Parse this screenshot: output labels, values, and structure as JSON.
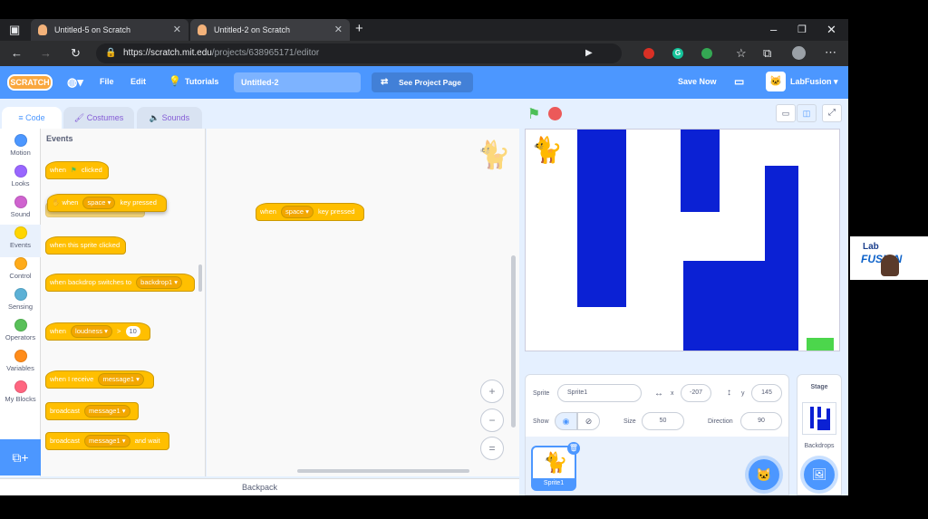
{
  "browser": {
    "tabs": [
      {
        "label": "Untitled-5 on Scratch",
        "active": false
      },
      {
        "label": "Untitled-2 on Scratch",
        "active": true
      }
    ],
    "url_host": "https://scratch.mit.edu",
    "url_path": "/projects/638965171/editor",
    "new_tab": "+",
    "back_icon": "arrow-left-icon",
    "window_icons": [
      "minimize-icon",
      "restore-icon",
      "close-icon"
    ]
  },
  "menu": {
    "logo": "SCRATCH",
    "file": "File",
    "edit": "Edit",
    "tutorials": "Tutorials",
    "project_title": "Untitled-2",
    "see_project": "See Project Page",
    "save_now": "Save Now",
    "username": "LabFusion"
  },
  "editor_tabs": {
    "code": "Code",
    "costumes": "Costumes",
    "sounds": "Sounds"
  },
  "categories": [
    {
      "label": "Motion",
      "color": "#4c97ff"
    },
    {
      "label": "Looks",
      "color": "#9966ff"
    },
    {
      "label": "Sound",
      "color": "#cf63cf"
    },
    {
      "label": "Events",
      "color": "#ffd500"
    },
    {
      "label": "Control",
      "color": "#ffab19"
    },
    {
      "label": "Sensing",
      "color": "#5cb1d6"
    },
    {
      "label": "Operators",
      "color": "#59c059"
    },
    {
      "label": "Variables",
      "color": "#ff8c1a"
    },
    {
      "label": "My Blocks",
      "color": "#ff6680"
    }
  ],
  "palette": {
    "heading": "Events",
    "blocks": {
      "flag_when": "when",
      "flag_clicked": "clicked",
      "key_when": "when",
      "key_value": "space",
      "key_pressed": "key pressed",
      "sprite_clicked": "when this sprite clicked",
      "backdrop_text": "when backdrop switches to",
      "backdrop_value": "backdrop1",
      "loud_when": "when",
      "loud_value": "loudness",
      "loud_gt": ">",
      "loud_num": "10",
      "receive_text": "when I receive",
      "receive_value": "message1",
      "broadcast_text": "broadcast",
      "broadcast_value": "message1",
      "bwait_text": "broadcast",
      "bwait_value": "message1",
      "bwait_tail": "and wait"
    }
  },
  "script": {
    "when": "when",
    "key": "space",
    "pressed": "key pressed"
  },
  "zoom": {
    "in": "+",
    "out": "−",
    "reset": "="
  },
  "backpack": "Backpack",
  "sprite_info": {
    "sprite_label": "Sprite",
    "sprite_name": "Sprite1",
    "x_label": "x",
    "x_value": "-207",
    "y_label": "y",
    "y_value": "145",
    "show_label": "Show",
    "size_label": "Size",
    "size_value": "50",
    "direction_label": "Direction",
    "direction_value": "90",
    "thumb_name": "Sprite1"
  },
  "stage_panel": {
    "title": "Stage",
    "backdrops": "Backdrops"
  },
  "webcam": {
    "brand_top": "Lab",
    "brand_bottom": "FUSION"
  }
}
